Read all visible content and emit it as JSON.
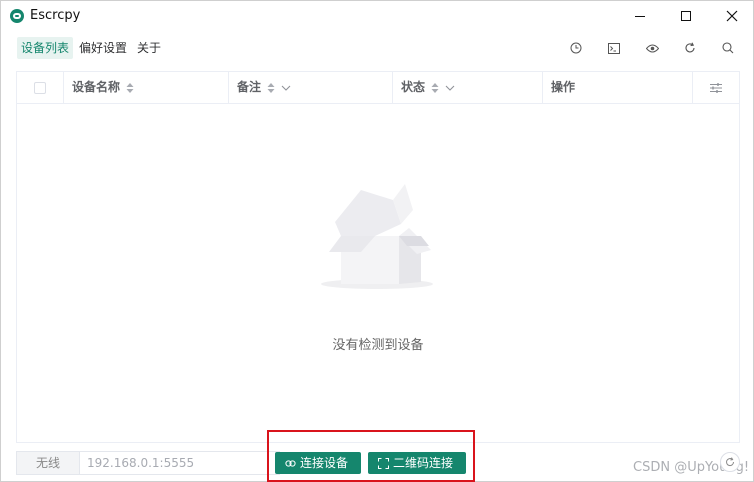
{
  "window": {
    "title": "Escrcpy",
    "controls": [
      "minimize",
      "maximize",
      "close"
    ]
  },
  "menu": {
    "items": [
      {
        "label": "设备列表",
        "active": true
      },
      {
        "label": "偏好设置",
        "active": false
      },
      {
        "label": "关于",
        "active": false
      }
    ]
  },
  "toolbar": {
    "icons": [
      "clock-icon",
      "terminal-icon",
      "eye-icon",
      "refresh-icon",
      "search-icon"
    ]
  },
  "table": {
    "columns": [
      {
        "label": "设备名称",
        "sortable": true,
        "filterable": false
      },
      {
        "label": "备注",
        "sortable": true,
        "filterable": true
      },
      {
        "label": "状态",
        "sortable": true,
        "filterable": true
      },
      {
        "label": "操作",
        "sortable": false,
        "filterable": false
      }
    ],
    "empty_text": "没有检测到设备"
  },
  "bottom": {
    "mode": "无线",
    "address_placeholder": "192.168.0.1:5555",
    "connect_label": "连接设备",
    "qr_label": "二维码连接"
  },
  "watermark": "CSDN @UpYoung!",
  "colors": {
    "accent": "#15866d",
    "accent_light": "#e7f3f0",
    "highlight_box": "#d9141c"
  }
}
